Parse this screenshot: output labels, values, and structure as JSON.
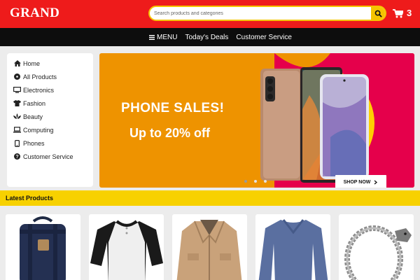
{
  "header": {
    "logo": "GRAND",
    "search_placeholder": "Search products and categories",
    "cart_count": "3",
    "icons": {
      "search": "search-icon",
      "cart": "cart-icon"
    },
    "colors": {
      "topbar": "#ee1b1b",
      "accent": "#f5c400"
    }
  },
  "nav": {
    "items": [
      {
        "label": "MENU",
        "icon": "hamburger-icon"
      },
      {
        "label": "Today's Deals"
      },
      {
        "label": "Customer Service"
      }
    ]
  },
  "sidebar": {
    "items": [
      {
        "label": "Home",
        "icon": "home-icon"
      },
      {
        "label": "All Products",
        "icon": "products-icon"
      },
      {
        "label": "Electronics",
        "icon": "monitor-icon"
      },
      {
        "label": "Fashion",
        "icon": "shirt-icon"
      },
      {
        "label": "Beauty",
        "icon": "beauty-icon"
      },
      {
        "label": "Computing",
        "icon": "laptop-icon"
      },
      {
        "label": "Phones",
        "icon": "phone-icon"
      },
      {
        "label": "Customer Service",
        "icon": "help-icon"
      }
    ]
  },
  "banner": {
    "headline": "PHONE SALES!",
    "subtitle": "Up to 20% off",
    "button": "SHOP NOW",
    "slide_count": 3,
    "active_slide": 1,
    "colors": {
      "background": "#ee9300",
      "shape": "#e5004b",
      "circle": "#ffd000"
    }
  },
  "latest": {
    "title": "Latest Products",
    "products": [
      {
        "name": "backpack",
        "icon": "backpack-image"
      },
      {
        "name": "raglan t-shirt",
        "icon": "tshirt-image"
      },
      {
        "name": "jacket",
        "icon": "jacket-image"
      },
      {
        "name": "sweater",
        "icon": "sweater-image"
      },
      {
        "name": "bracelet",
        "icon": "bracelet-image"
      }
    ]
  }
}
